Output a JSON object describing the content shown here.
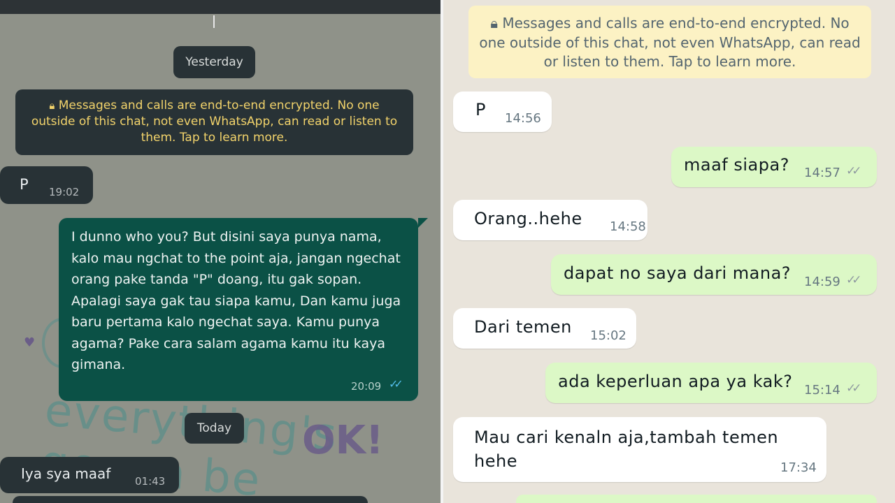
{
  "left_chat": {
    "date_yesterday": "Yesterday",
    "encryption_notice": "Messages and calls are end-to-end encrypted. No one outside of this chat, not even WhatsApp, can read or listen to them. Tap to learn more.",
    "messages": [
      {
        "direction": "incoming",
        "text": "P",
        "time": "19:02"
      },
      {
        "direction": "outgoing",
        "text": "I dunno who you?  But disini saya punya nama, kalo mau ngchat to the point aja, jangan ngechat orang pake tanda \"P\" doang, itu gak sopan. Apalagi saya gak tau siapa kamu, Dan kamu juga baru pertama kalo ngechat saya. Kamu punya agama? Pake cara salam agama kamu itu kaya gimana.",
        "time": "20:09",
        "status": "read"
      },
      {
        "direction": "incoming",
        "text": "Iya sya maaf",
        "time": "01:43"
      }
    ],
    "date_today": "Today",
    "wallpaper_text": "everything's gonna be",
    "wallpaper_ok": "OK!",
    "colors": {
      "background": "#8f9289",
      "bubble_in": "#283236",
      "bubble_out": "#0b5146",
      "notice_text": "#f2d36b",
      "read_ticks": "#53bdeb"
    }
  },
  "right_chat": {
    "encryption_notice": "Messages and calls are end-to-end encrypted. No one outside of this chat, not even WhatsApp, can read or listen to them. Tap to learn more.",
    "messages": [
      {
        "direction": "incoming",
        "text": "P",
        "time": "14:56"
      },
      {
        "direction": "outgoing",
        "text": "maaf siapa?",
        "time": "14:57",
        "status": "delivered"
      },
      {
        "direction": "incoming",
        "text": "Orang..hehe",
        "time": "14:58"
      },
      {
        "direction": "outgoing",
        "text": "dapat no saya dari mana?",
        "time": "14:59",
        "status": "delivered"
      },
      {
        "direction": "incoming",
        "text": "Dari temen",
        "time": "15:02"
      },
      {
        "direction": "outgoing",
        "text": "ada keperluan apa ya kak?",
        "time": "15:14",
        "status": "delivered"
      },
      {
        "direction": "incoming",
        "text": "Mau cari kenaln aja,tambah temen hehe",
        "time": "17:34"
      }
    ],
    "colors": {
      "background": "#e9e4db",
      "bubble_in": "#ffffff",
      "bubble_out": "#dcf8c6",
      "notice_bg": "#fcf2c4"
    }
  },
  "icons": {
    "lock": "lock-icon",
    "ticks": "double-check-icon"
  }
}
